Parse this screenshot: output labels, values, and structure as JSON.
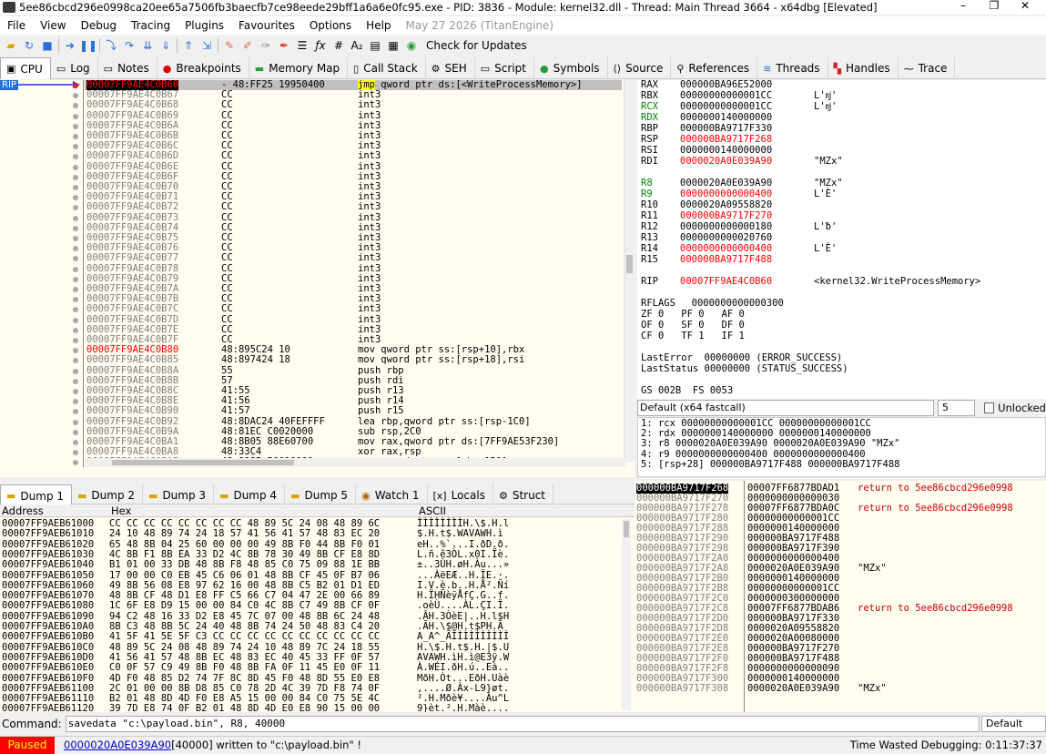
{
  "title": "5ee86cbcd296e0998ca20ee65a7506fb3baecfb7ce98eede29bff1a6a6e0fc95.exe - PID: 3836 - Module: kernel32.dll - Thread: Main Thread 3664 - x64dbg [Elevated]",
  "menu": [
    "File",
    "View",
    "Debug",
    "Tracing",
    "Plugins",
    "Favourites",
    "Options",
    "Help"
  ],
  "menu_date": "May 27 2026 (TitanEngine)",
  "toolbar_check_updates": "Check for Updates",
  "tabs": [
    "CPU",
    "Log",
    "Notes",
    "Breakpoints",
    "Memory Map",
    "Call Stack",
    "SEH",
    "Script",
    "Symbols",
    "Source",
    "References",
    "Threads",
    "Handles",
    "Trace"
  ],
  "rip_label": "RIP",
  "disasm": [
    {
      "addr": "00007FF9AE4C0B60",
      "bytes": "- 48:FF25 19950400",
      "mn": "jmp",
      "op": " qword ptr ds:[<WriteProcessMemory>]"
    },
    {
      "addr": "00007FF9AE4C0B67",
      "bytes": "CC",
      "mn": "int3",
      "op": ""
    },
    {
      "addr": "00007FF9AE4C0B68",
      "bytes": "CC",
      "mn": "int3",
      "op": ""
    },
    {
      "addr": "00007FF9AE4C0B69",
      "bytes": "CC",
      "mn": "int3",
      "op": ""
    },
    {
      "addr": "00007FF9AE4C0B6A",
      "bytes": "CC",
      "mn": "int3",
      "op": ""
    },
    {
      "addr": "00007FF9AE4C0B6B",
      "bytes": "CC",
      "mn": "int3",
      "op": ""
    },
    {
      "addr": "00007FF9AE4C0B6C",
      "bytes": "CC",
      "mn": "int3",
      "op": ""
    },
    {
      "addr": "00007FF9AE4C0B6D",
      "bytes": "CC",
      "mn": "int3",
      "op": ""
    },
    {
      "addr": "00007FF9AE4C0B6E",
      "bytes": "CC",
      "mn": "int3",
      "op": ""
    },
    {
      "addr": "00007FF9AE4C0B6F",
      "bytes": "CC",
      "mn": "int3",
      "op": ""
    },
    {
      "addr": "00007FF9AE4C0B70",
      "bytes": "CC",
      "mn": "int3",
      "op": ""
    },
    {
      "addr": "00007FF9AE4C0B71",
      "bytes": "CC",
      "mn": "int3",
      "op": ""
    },
    {
      "addr": "00007FF9AE4C0B72",
      "bytes": "CC",
      "mn": "int3",
      "op": ""
    },
    {
      "addr": "00007FF9AE4C0B73",
      "bytes": "CC",
      "mn": "int3",
      "op": ""
    },
    {
      "addr": "00007FF9AE4C0B74",
      "bytes": "CC",
      "mn": "int3",
      "op": ""
    },
    {
      "addr": "00007FF9AE4C0B75",
      "bytes": "CC",
      "mn": "int3",
      "op": ""
    },
    {
      "addr": "00007FF9AE4C0B76",
      "bytes": "CC",
      "mn": "int3",
      "op": ""
    },
    {
      "addr": "00007FF9AE4C0B77",
      "bytes": "CC",
      "mn": "int3",
      "op": ""
    },
    {
      "addr": "00007FF9AE4C0B78",
      "bytes": "CC",
      "mn": "int3",
      "op": ""
    },
    {
      "addr": "00007FF9AE4C0B79",
      "bytes": "CC",
      "mn": "int3",
      "op": ""
    },
    {
      "addr": "00007FF9AE4C0B7A",
      "bytes": "CC",
      "mn": "int3",
      "op": ""
    },
    {
      "addr": "00007FF9AE4C0B7B",
      "bytes": "CC",
      "mn": "int3",
      "op": ""
    },
    {
      "addr": "00007FF9AE4C0B7C",
      "bytes": "CC",
      "mn": "int3",
      "op": ""
    },
    {
      "addr": "00007FF9AE4C0B7D",
      "bytes": "CC",
      "mn": "int3",
      "op": ""
    },
    {
      "addr": "00007FF9AE4C0B7E",
      "bytes": "CC",
      "mn": "int3",
      "op": ""
    },
    {
      "addr": "00007FF9AE4C0B7F",
      "bytes": "CC",
      "mn": "int3",
      "op": ""
    },
    {
      "addr": "00007FF9AE4C0B80",
      "bytes": "48:895C24 10",
      "mn": "mov",
      "op": " qword ptr ss:[rsp+10],rbx"
    },
    {
      "addr": "00007FF9AE4C0B85",
      "bytes": "48:897424 18",
      "mn": "mov",
      "op": " qword ptr ss:[rsp+18],rsi"
    },
    {
      "addr": "00007FF9AE4C0B8A",
      "bytes": "55",
      "mn": "push",
      "op": " rbp"
    },
    {
      "addr": "00007FF9AE4C0B8B",
      "bytes": "57",
      "mn": "push",
      "op": " rdi"
    },
    {
      "addr": "00007FF9AE4C0B8C",
      "bytes": "41:55",
      "mn": "push",
      "op": " r13"
    },
    {
      "addr": "00007FF9AE4C0B8E",
      "bytes": "41:56",
      "mn": "push",
      "op": " r14"
    },
    {
      "addr": "00007FF9AE4C0B90",
      "bytes": "41:57",
      "mn": "push",
      "op": " r15"
    },
    {
      "addr": "00007FF9AE4C0B92",
      "bytes": "48:8DAC24 40FEFFFF",
      "mn": "lea",
      "op": " rbp,qword ptr ss:[rsp-1C0]"
    },
    {
      "addr": "00007FF9AE4C0B9A",
      "bytes": "48:81EC C0020000",
      "mn": "sub",
      "op": " rsp,2C0"
    },
    {
      "addr": "00007FF9AE4C0BA1",
      "bytes": "48:8B05 88E60700",
      "mn": "mov",
      "op": " rax,qword ptr ds:[7FF9AE53F230]"
    },
    {
      "addr": "00007FF9AE4C0BA8",
      "bytes": "48:33C4",
      "mn": "xor",
      "op": " rax,rsp"
    },
    {
      "addr": "00007FF9AE4C0BAB",
      "bytes": "48:8985 B0010000",
      "mn": "mov",
      "op": " qword ptr ss:[rbp+1B0],rax"
    }
  ],
  "registers": [
    {
      "n": "RAX",
      "v": "000000BA96E52000",
      "c": "",
      "cls": ""
    },
    {
      "n": "RBX",
      "v": "00000000000001CC",
      "c": "L'ǌ'",
      "cls": ""
    },
    {
      "n": "RCX",
      "v": "00000000000001CC",
      "c": "L'ǌ'",
      "cls": "green"
    },
    {
      "n": "RDX",
      "v": "0000000140000000",
      "c": "",
      "cls": "green"
    },
    {
      "n": "RBP",
      "v": "000000BA9717F330",
      "c": "",
      "cls": ""
    },
    {
      "n": "RSP",
      "v": "000000BA9717F268",
      "c": "",
      "cls": "redv"
    },
    {
      "n": "RSI",
      "v": "0000000140000000",
      "c": "",
      "cls": ""
    },
    {
      "n": "RDI",
      "v": "0000020A0E039A90",
      "c": "\"MZx\"",
      "cls": "redv"
    },
    {
      "n": "",
      "v": "",
      "c": "",
      "cls": ""
    },
    {
      "n": "R8",
      "v": "0000020A0E039A90",
      "c": "\"MZx\"",
      "cls": "green"
    },
    {
      "n": "R9",
      "v": "0000000000000400",
      "c": "L'Ѐ'",
      "cls": "greenred"
    },
    {
      "n": "R10",
      "v": "0000020A09558820",
      "c": "",
      "cls": ""
    },
    {
      "n": "R11",
      "v": "000000BA9717F270",
      "c": "",
      "cls": "redv"
    },
    {
      "n": "R12",
      "v": "0000000000000180",
      "c": "L'ƀ'",
      "cls": ""
    },
    {
      "n": "R13",
      "v": "0000000000020760",
      "c": "",
      "cls": ""
    },
    {
      "n": "R14",
      "v": "0000000000000400",
      "c": "L'Ѐ'",
      "cls": "redv"
    },
    {
      "n": "R15",
      "v": "000000BA9717F488",
      "c": "",
      "cls": "redv"
    },
    {
      "n": "",
      "v": "",
      "c": "",
      "cls": ""
    },
    {
      "n": "RIP",
      "v": "00007FF9AE4C0B60",
      "c": "<kernel32.WriteProcessMemory>",
      "cls": "redv"
    },
    {
      "n": "",
      "v": "",
      "c": "",
      "cls": ""
    },
    {
      "n": "RFLAGS",
      "v": "  0000000000000300",
      "c": "",
      "cls": ""
    },
    {
      "n": "ZF 0   PF 0   AF 0",
      "v": "",
      "c": "",
      "cls": ""
    },
    {
      "n": "OF 0   SF 0   DF 0",
      "v": "",
      "c": "",
      "cls": ""
    },
    {
      "n": "CF 0   TF 1   IF 1",
      "v": "",
      "c": "",
      "cls": ""
    },
    {
      "n": "",
      "v": "",
      "c": "",
      "cls": ""
    },
    {
      "n": "LastError  00000000 (ERROR_SUCCESS)",
      "v": "",
      "c": "",
      "cls": ""
    },
    {
      "n": "LastStatus 00000000 (STATUS_SUCCESS)",
      "v": "",
      "c": "",
      "cls": ""
    },
    {
      "n": "",
      "v": "",
      "c": "",
      "cls": ""
    },
    {
      "n": "GS 002B  FS 0053",
      "v": "",
      "c": "",
      "cls": ""
    }
  ],
  "callconv": {
    "value": "Default (x64 fastcall)",
    "count": "5",
    "unlocked": "Unlocked"
  },
  "args": [
    "1: rcx 00000000000001CC 00000000000001CC",
    "2: rdx 0000000140000000 0000000140000000",
    "3: r8 0000020A0E039A90 0000020A0E039A90 \"MZx\"",
    "4: r9 0000000000000400 0000000000000400",
    "5: [rsp+28] 000000BA9717F488 000000BA9717F488"
  ],
  "bottom_tabs": [
    "Dump 1",
    "Dump 2",
    "Dump 3",
    "Dump 4",
    "Dump 5",
    "Watch 1",
    "Locals",
    "Struct"
  ],
  "dump_headers": {
    "address": "Address",
    "hex": "Hex",
    "ascii": "ASCII"
  },
  "dump": [
    {
      "a": "00007FF9AEB61000",
      "h": "CC CC CC CC CC CC CC CC 48 89 5C 24 08 48 89 6C",
      "s": "ÌÌÌÌÌÌÌÌH.\\$.H.l"
    },
    {
      "a": "00007FF9AEB61010",
      "h": "24 10 48 89 74 24 18 57 41 56 41 57 48 83 EC 20",
      "s": "$.H.t$.WAVAWH.ì "
    },
    {
      "a": "00007FF9AEB61020",
      "h": "65 48 8B 04 25 60 00 00 00 49 8B F0 44 8B F0 01",
      "s": "eH..%`...I.ðD.ð."
    },
    {
      "a": "00007FF9AEB61030",
      "h": "4C 8B F1 8B EA 33 D2 4C 8B 78 30 49 8B CF E8 8D",
      "s": "L.ñ.ê3ÒL.x0I.Ïè."
    },
    {
      "a": "00007FF9AEB61040",
      "h": "B1 01 00 33 DB 48 8B F8 48 85 C0 75 09 88 1E BB",
      "s": "±..3ÛH.øH.Àu...»"
    },
    {
      "a": "00007FF9AEB61050",
      "h": "17 00 00 C0 EB 45 C6 06 01 48 8B CF 45 0F B7 06",
      "s": "...ÀëEÆ..H.ÏE.·."
    },
    {
      "a": "00007FF9AEB61060",
      "h": "49 8B 56 08 E8 97 62 16 00 48 8B C5 B2 01 D1 ED",
      "s": "I.V.è.b..H.Å².Ñí"
    },
    {
      "a": "00007FF9AEB61070",
      "h": "48 8B CF 48 D1 E8 FF C5 66 C7 04 47 2E 00 66 89",
      "s": "H.ÏHÑèÿÅfÇ.G..f."
    },
    {
      "a": "00007FF9AEB61080",
      "h": "1C 6F E8 D9 15 00 00 84 C0 4C 8B C7 49 8B CF 0F",
      "s": ".oèÙ....ÀL.ÇI.Ï."
    },
    {
      "a": "00007FF9AEB61090",
      "h": "94 C2 48 16 33 D2 E8 45 7C 07 00 48 8B 6C 24 48",
      "s": ".ÂH.3ÒèE|..H.l$H"
    },
    {
      "a": "00007FF9AEB610A0",
      "h": "8B C3 48 8B 5C 24 40 48 8B 74 24 50 48 83 C4 20",
      "s": ".ÃH.\\$@H.t$PH.Ä "
    },
    {
      "a": "00007FF9AEB610B0",
      "h": "41 5F 41 5E 5F C3 CC CC CC CC CC CC CC CC CC CC",
      "s": "A_A^_ÃÌÌÌÌÌÌÌÌÌÌ"
    },
    {
      "a": "00007FF9AEB610C0",
      "h": "48 89 5C 24 08 48 89 74 24 10 48 89 7C 24 18 55",
      "s": "H.\\$.H.t$.H.|$.U"
    },
    {
      "a": "00007FF9AEB610D0",
      "h": "41 56 41 57 48 8B EC 48 83 EC 40 45 33 FF 0F 57",
      "s": "AVAWH.ìH.ì@E3ÿ.W"
    },
    {
      "a": "00007FF9AEB610E0",
      "h": "C0 0F 57 C9 49 8B F0 48 8B FA 0F 11 45 E0 0F 11",
      "s": "À.WÉI.ðH.ú..Eà.."
    },
    {
      "a": "00007FF9AEB610F0",
      "h": "4D F0 48 85 D2 74 7F 8C 8D 45 F0 48 8D 55 E0 E8",
      "s": "MðH.Òt...EðH.Uàè"
    },
    {
      "a": "00007FF9AEB61100",
      "h": "2C 01 00 00 8B D8 85 C0 78 2D 4C 39 7D F8 74 0F",
      "s": ",....Ø.Àx-L9}øt."
    },
    {
      "a": "00007FF9AEB61110",
      "h": "B2 01 48 8D 4D F0 E8 A5 15 00 00 84 C0 75 5E 4C",
      "s": "².H.Mðè¥....Àu^L"
    },
    {
      "a": "00007FF9AEB61120",
      "h": "39 7D E8 74 0F B2 01 48 8D 4D E0 E8 90 15 00 00",
      "s": "9}èt.².H.Màè...."
    }
  ],
  "stack": [
    {
      "a": "000000BA9717F268",
      "v": "00007FF6877BDAD1",
      "c": "return to 5ee86cbcd296e0998"
    },
    {
      "a": "000000BA9717F270",
      "v": "0000000000000030",
      "c": ""
    },
    {
      "a": "000000BA9717F278",
      "v": "00007FF6877BDA0C",
      "c": "return to 5ee86cbcd296e0998"
    },
    {
      "a": "000000BA9717F280",
      "v": "00000000000001CC",
      "c": ""
    },
    {
      "a": "000000BA9717F288",
      "v": "0000000140000000",
      "c": ""
    },
    {
      "a": "000000BA9717F290",
      "v": "000000BA9717F488",
      "c": ""
    },
    {
      "a": "000000BA9717F298",
      "v": "000000BA9717F390",
      "c": ""
    },
    {
      "a": "000000BA9717F2A0",
      "v": "0000000000000400",
      "c": ""
    },
    {
      "a": "000000BA9717F2A8",
      "v": "0000020A0E039A90",
      "c": "\"MZx\""
    },
    {
      "a": "000000BA9717F2B0",
      "v": "0000000140000000",
      "c": ""
    },
    {
      "a": "000000BA9717F2B8",
      "v": "00000000000001CC",
      "c": ""
    },
    {
      "a": "000000BA9717F2C0",
      "v": "0000000300000000",
      "c": ""
    },
    {
      "a": "000000BA9717F2C8",
      "v": "00007FF6877BDAB6",
      "c": "return to 5ee86cbcd296e0998"
    },
    {
      "a": "000000BA9717F2D0",
      "v": "000000BA9717F330",
      "c": ""
    },
    {
      "a": "000000BA9717F2D8",
      "v": "0000020A09558820",
      "c": ""
    },
    {
      "a": "000000BA9717F2E0",
      "v": "0000020A00080000",
      "c": ""
    },
    {
      "a": "000000BA9717F2E8",
      "v": "000000BA9717F270",
      "c": ""
    },
    {
      "a": "000000BA9717F2F0",
      "v": "000000BA9717F488",
      "c": ""
    },
    {
      "a": "000000BA9717F2F8",
      "v": "0000000000000090",
      "c": ""
    },
    {
      "a": "000000BA9717F300",
      "v": "0000000140000000",
      "c": ""
    },
    {
      "a": "000000BA9717F308",
      "v": "0000020A0E039A90",
      "c": "\"MZx\""
    }
  ],
  "command": {
    "label": "Command:",
    "value": "savedata \"c:\\payload.bin\", R8, 40000",
    "mode": "Default"
  },
  "status": {
    "state": "Paused",
    "link": "0000020A0E039A90",
    "msg": "[40000] written to \"c:\\payload.bin\" !",
    "time": "Time Wasted Debugging: 0:11:37:37"
  }
}
